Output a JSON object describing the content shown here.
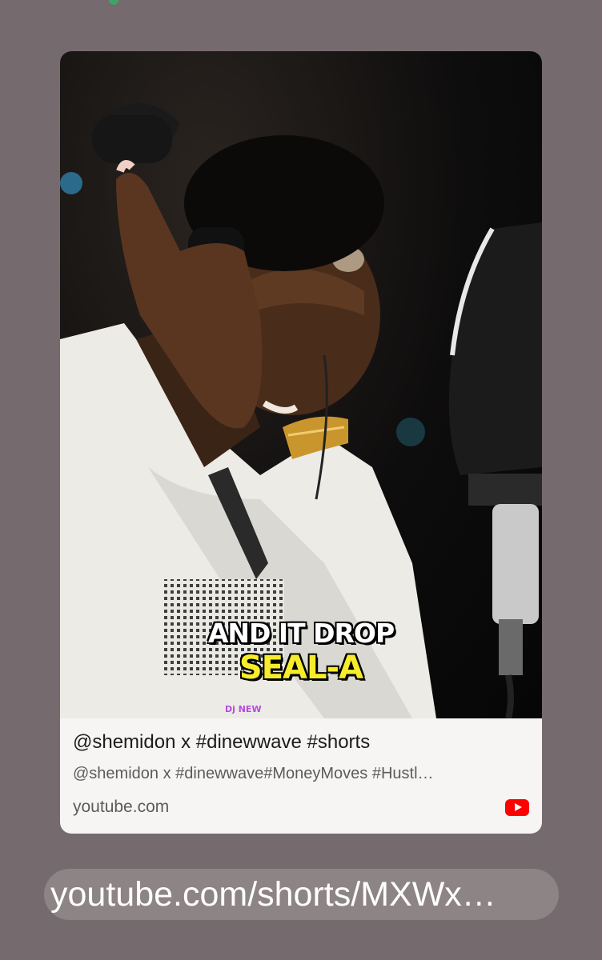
{
  "card": {
    "caption_line1": "AND IT DROP",
    "caption_line2": "SEAL-A",
    "watermark": "Dj NEW",
    "title": "@shemidon x #dinewwave #shorts",
    "description": "@shemidon x #dinewwave#MoneyMoves #Hustl…",
    "domain": "youtube.com",
    "icon": "youtube-icon"
  },
  "message": {
    "link_text": "youtube.com/shorts/MXWx…"
  },
  "colors": {
    "background": "#756b6e",
    "card": "#f6f5f4",
    "caption_yellow": "#f6ec2b",
    "youtube_red": "#ff0000"
  }
}
